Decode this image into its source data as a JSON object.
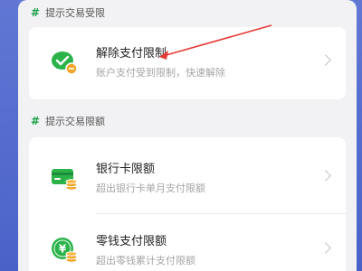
{
  "sections": [
    {
      "header": "提示交易受限",
      "items": [
        {
          "title": "解除支付限制",
          "desc": "账户支付受到限制，快速解除",
          "icon": "wechat-pay-restrict-icon"
        }
      ]
    },
    {
      "header": "提示交易限额",
      "items": [
        {
          "title": "银行卡限额",
          "desc": "超出银行卡单月支付限额",
          "icon": "bank-card-coin-icon"
        },
        {
          "title": "零钱支付限额",
          "desc": "超出零钱累计支付限额",
          "icon": "yuan-coin-icon"
        }
      ]
    }
  ],
  "colors": {
    "accent": "#1aa04a",
    "annotation": "#e53935",
    "background": "#5068cc"
  }
}
